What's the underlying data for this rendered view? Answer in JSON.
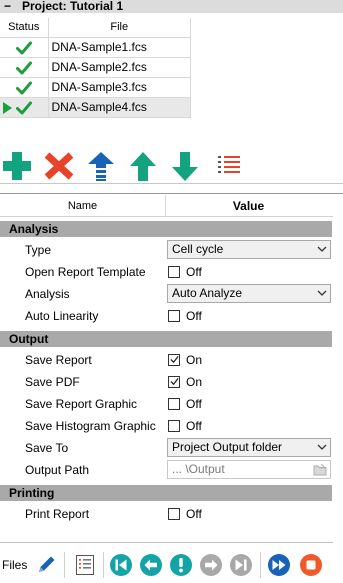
{
  "project": {
    "collapse_symbol": "−",
    "title": "Project:  Tutorial 1",
    "columns": {
      "status": "Status",
      "file": "File"
    },
    "files": [
      {
        "name": "DNA-Sample1.fcs",
        "status": "check-icon"
      },
      {
        "name": "DNA-Sample2.fcs",
        "status": "check-icon"
      },
      {
        "name": "DNA-Sample3.fcs",
        "status": "check-icon"
      },
      {
        "name": "DNA-Sample4.fcs",
        "status": "check-icon",
        "current": true
      }
    ]
  },
  "toolbar": {
    "buttons": [
      "add-icon",
      "remove-icon",
      "move-to-top-icon",
      "move-up-icon",
      "move-down-icon",
      "list-icon"
    ]
  },
  "properties": {
    "header": {
      "name": "Name",
      "value": "Value"
    },
    "sections": {
      "analysis": {
        "title": "Analysis",
        "type_label": "Type",
        "type_value": "Cell cycle",
        "open_report_template_label": "Open Report Template",
        "open_report_template_value": "Off",
        "analysis_label": "Analysis",
        "analysis_value": "Auto Analyze",
        "auto_linearity_label": "Auto Linearity",
        "auto_linearity_value": "Off"
      },
      "output": {
        "title": "Output",
        "save_report_label": "Save Report",
        "save_report_value": "On",
        "save_pdf_label": "Save PDF",
        "save_pdf_value": "On",
        "save_report_graphic_label": "Save Report Graphic",
        "save_report_graphic_value": "Off",
        "save_histogram_graphic_label": "Save Histogram Graphic",
        "save_histogram_graphic_value": "Off",
        "save_to_label": "Save To",
        "save_to_value": "Project Output folder",
        "output_path_label": "Output Path",
        "output_path_value": "... \\Output"
      },
      "printing": {
        "title": "Printing",
        "print_report_label": "Print Report",
        "print_report_value": "Off"
      }
    }
  },
  "bottom": {
    "files_label": "Files",
    "buttons": [
      "edit-icon",
      "report-list-icon",
      "first-icon",
      "previous-icon",
      "alert-icon",
      "next-icon",
      "last-icon",
      "fast-forward-icon",
      "stop-icon"
    ]
  },
  "colors": {
    "green": "#1e9e3a",
    "teal": "#14a37f",
    "red": "#e8432a",
    "blue": "#1763b8",
    "nav_teal": "#14a3a6",
    "stop_orange": "#f05a28",
    "section_gray": "#a9a9a9"
  }
}
